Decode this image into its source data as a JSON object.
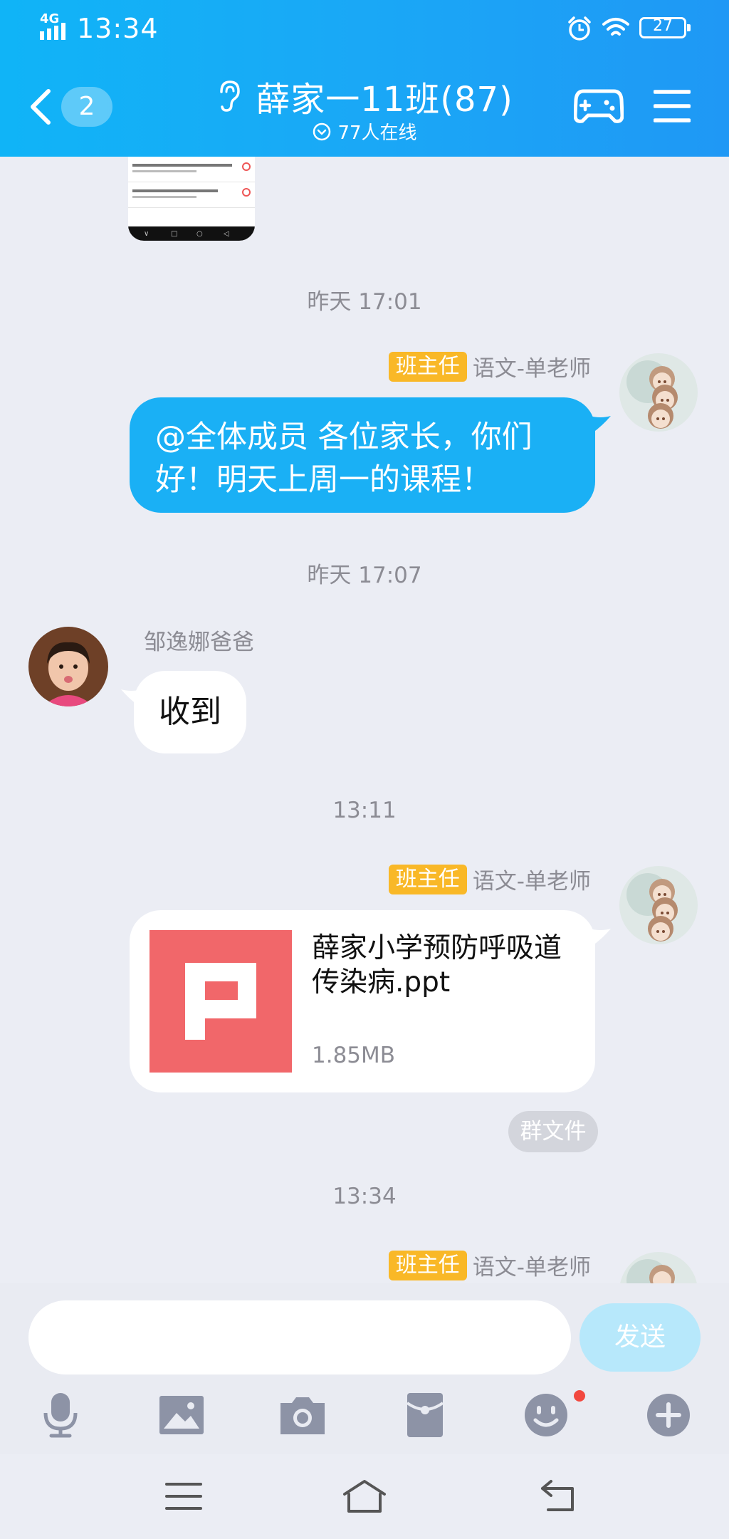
{
  "status_bar": {
    "network": "4G",
    "time": "13:34",
    "battery": "27"
  },
  "header": {
    "unread_count": "2",
    "title": "薛家一11班(87)",
    "online": "77人在线"
  },
  "messages": [
    {
      "type": "timestamp",
      "text": "昨天 17:01"
    },
    {
      "type": "outgoing_text",
      "role": "班主任",
      "sender": "语文-单老师",
      "text": "@全体成员 各位家长，你们好！明天上周一的课程！"
    },
    {
      "type": "timestamp",
      "text": "昨天 17:07"
    },
    {
      "type": "incoming_text",
      "sender": "邹逸娜爸爸",
      "text": "收到"
    },
    {
      "type": "timestamp",
      "text": "13:11"
    },
    {
      "type": "outgoing_file",
      "role": "班主任",
      "sender": "语文-单老师",
      "file_name": "薛家小学预防呼吸道传染病.ppt",
      "file_size": "1.85MB",
      "tag": "群文件"
    },
    {
      "type": "timestamp",
      "text": "13:34"
    },
    {
      "type": "outgoing_partial",
      "role": "班主任",
      "sender": "语文-单老师"
    }
  ],
  "input": {
    "value": "",
    "send_label": "发送"
  },
  "toolbar": [
    "microphone-icon",
    "image-icon",
    "camera-icon",
    "red-packet-icon",
    "emoji-icon",
    "plus-icon"
  ],
  "colors": {
    "header": "#1aa8f6",
    "bubble_out": "#1ab0f5",
    "role_badge": "#f9b827",
    "ppt": "#f1676a",
    "background": "#ebedf4"
  }
}
